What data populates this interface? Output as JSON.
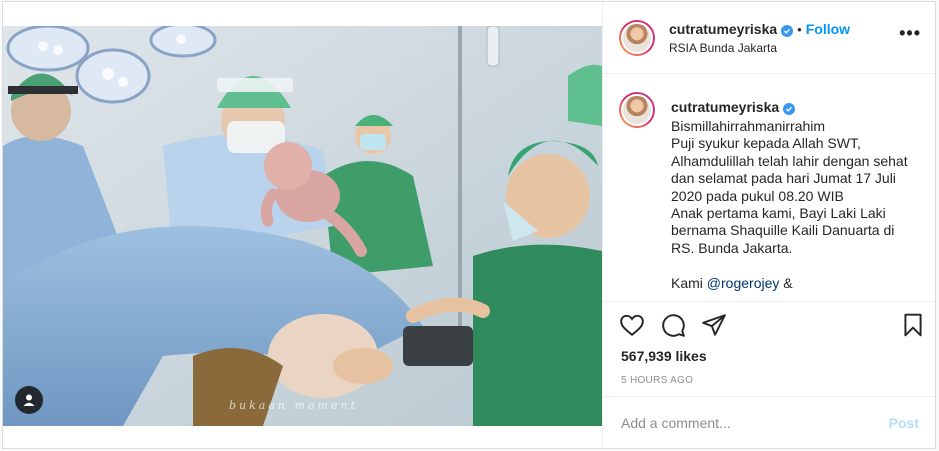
{
  "post": {
    "username": "cutratumeyriska",
    "verified": true,
    "follow_label": "Follow",
    "separator": "•",
    "location": "RSIA Bunda Jakarta",
    "more_label": "•••",
    "photo_watermark": "bukaan moment",
    "caption": {
      "username": "cutratumeyriska",
      "lines": [
        "Bismillahirrahmanirrahim",
        "Puji syukur kepada Allah SWT, Alhamdulillah telah lahir dengan sehat dan selamat pada hari Jumat 17 Juli 2020 pada pukul 08.20 WIB",
        "Anak pertama kami, Bayi Laki Laki bernama Shaquille Kaili Danuarta di RS. Bunda Jakarta."
      ],
      "last_prefix": "Kami ",
      "last_mention": "@rogerojey",
      "last_suffix": " &"
    },
    "likes": "567,939 likes",
    "timestamp": "5 HOURS AGO",
    "comment": {
      "placeholder": "Add a comment...",
      "value": "",
      "post_label": "Post"
    }
  },
  "icons": {
    "like": "heart-icon",
    "comment": "comment-bubble-icon",
    "share": "paper-plane-icon",
    "save": "bookmark-icon",
    "tag": "user-tag-icon"
  },
  "colors": {
    "accent": "#0095f6",
    "verified": "#3897f0",
    "post_disabled": "#b2dffc",
    "muted": "#8e8e8e"
  }
}
